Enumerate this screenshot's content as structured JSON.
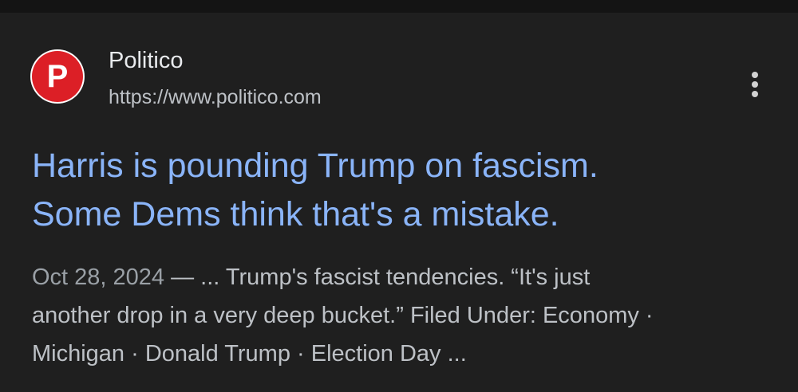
{
  "result": {
    "site_name": "Politico",
    "site_url": "https://www.politico.com",
    "favicon_letter": "P",
    "favicon_color": "#dc1f26",
    "more_icon": "more-vert-icon",
    "title_lines": [
      "Harris is pounding Trump on fascism.",
      "Some Dems think that's a mistake."
    ],
    "date": "Oct 28, 2024",
    "snippet_lines": [
      " — ... Trump's fascist tendencies. “It's just",
      "another drop in a very deep bucket.” Filed Under: Economy ·",
      "Michigan · Donald Trump · Election Day ..."
    ]
  },
  "colors": {
    "background": "#1f1f1f",
    "title_link": "#8ab4f8",
    "snippet_text": "#bdc1c6",
    "site_name_text": "#e8eaed"
  }
}
